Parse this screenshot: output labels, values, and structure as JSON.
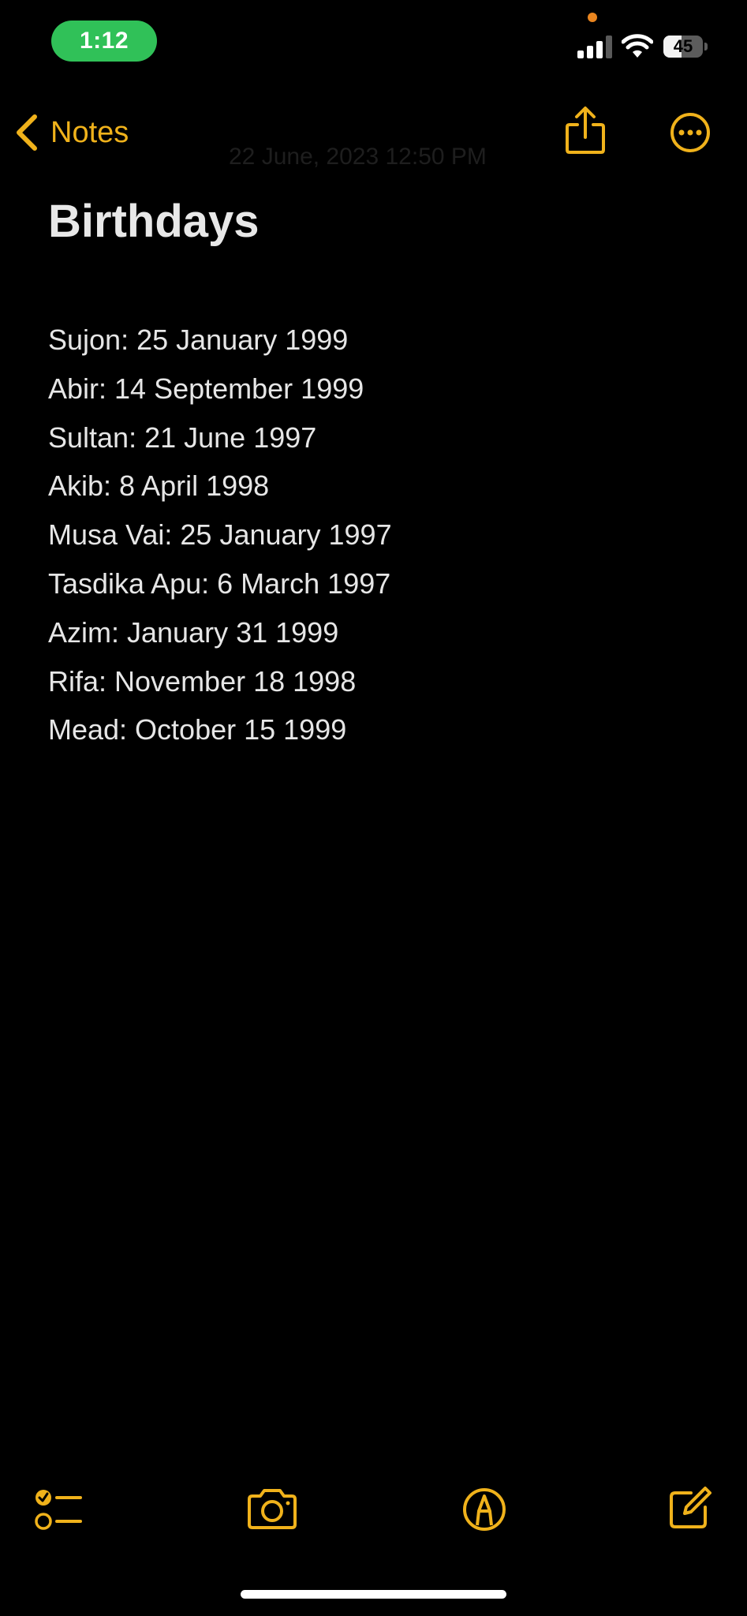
{
  "status_bar": {
    "time": "1:12",
    "battery_percent": "45",
    "battery_level": 0.45,
    "signal_bars_active": 3,
    "signal_bars_total": 4,
    "icons": [
      "cellular-signal-icon",
      "wifi-icon",
      "battery-icon"
    ],
    "colors": {
      "time_pill": "#30c158",
      "mic_indicator": "#e9851f"
    }
  },
  "nav": {
    "back_label": "Notes",
    "faded_date": "22 June, 2023 12:50 PM",
    "icons": [
      "chevron-left-icon",
      "share-icon",
      "ellipsis-circle-icon"
    ]
  },
  "note": {
    "title": "Birthdays",
    "lines": [
      "Sujon: 25 January 1999",
      "Abir: 14 September 1999",
      "Sultan: 21 June 1997",
      "Akib: 8 April 1998",
      "Musa Vai: 25 January 1997",
      "Tasdika Apu: 6 March 1997",
      "Azim: January 31 1999",
      "Rifa: November 18 1998",
      "Mead: October 15 1999"
    ]
  },
  "toolbar": {
    "icons": [
      "checklist-icon",
      "camera-icon",
      "markup-pen-icon",
      "compose-icon"
    ]
  },
  "theme": {
    "accent": "#f0b21b",
    "background": "#000000",
    "text": "#e6e6e6"
  }
}
